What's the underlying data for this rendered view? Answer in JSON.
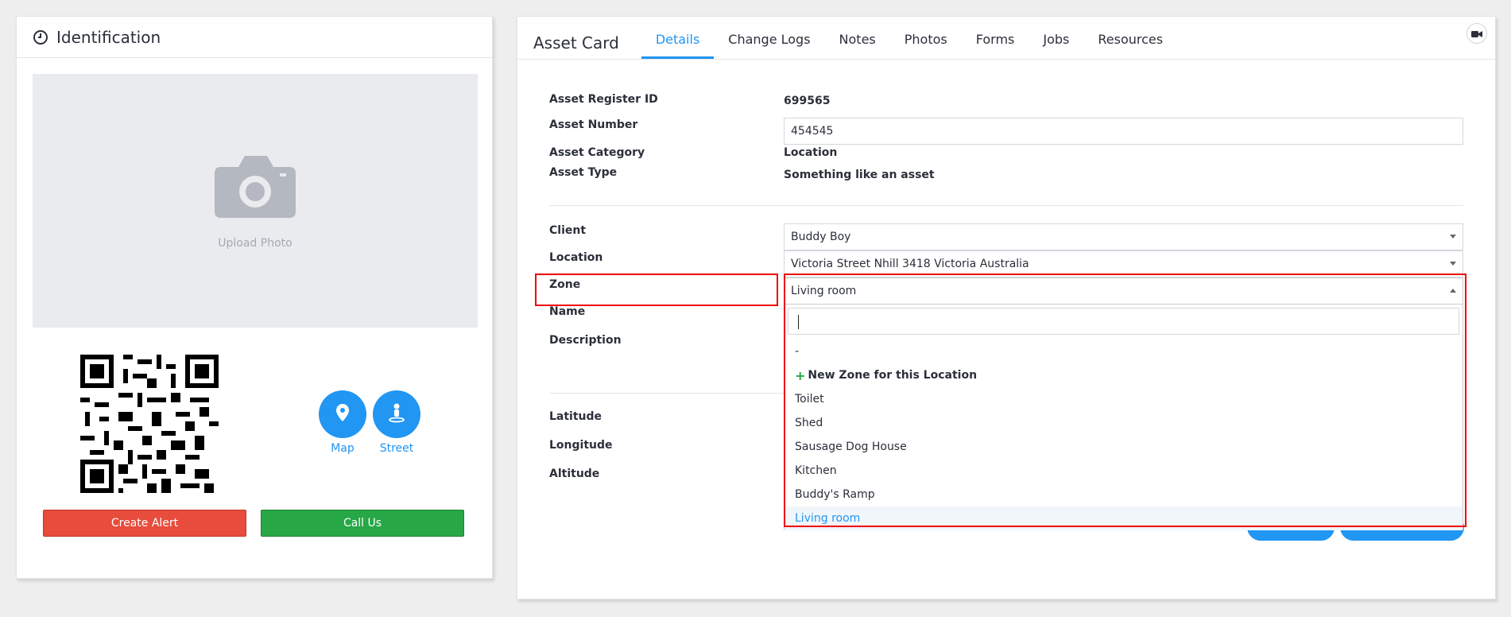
{
  "left_panel": {
    "title": "Identification",
    "upload_label": "Upload Photo",
    "map_label": "Map",
    "street_label": "Street",
    "create_alert_label": "Create Alert",
    "call_us_label": "Call Us"
  },
  "right_panel": {
    "title": "Asset Card",
    "tabs": [
      {
        "label": "Details",
        "active": true
      },
      {
        "label": "Change Logs"
      },
      {
        "label": "Notes"
      },
      {
        "label": "Photos"
      },
      {
        "label": "Forms"
      },
      {
        "label": "Jobs"
      },
      {
        "label": "Resources"
      }
    ]
  },
  "details": {
    "asset_register_id_label": "Asset Register ID",
    "asset_register_id_value": "699565",
    "asset_number_label": "Asset Number",
    "asset_number_value": "454545",
    "asset_category_label": "Asset Category",
    "asset_category_value": "Location",
    "asset_type_label": "Asset Type",
    "asset_type_value": "Something like an asset",
    "client_label": "Client",
    "client_value": "Buddy Boy",
    "location_label": "Location",
    "location_value": "Victoria Street Nhill 3418 Victoria Australia",
    "zone_label": "Zone",
    "zone_value": "Living room",
    "name_label": "Name",
    "description_label": "Description",
    "latitude_label": "Latitude",
    "longitude_label": "Longitude",
    "altitude_label": "Altitude"
  },
  "zone_dropdown": {
    "search_value": "",
    "options": [
      {
        "label": "-"
      },
      {
        "label": "New Zone for this Location"
      },
      {
        "label": "Toilet"
      },
      {
        "label": "Shed"
      },
      {
        "label": "Sausage Dog House"
      },
      {
        "label": "Kitchen"
      },
      {
        "label": "Buddy's Ramp"
      },
      {
        "label": "Living room"
      }
    ]
  },
  "colors": {
    "accent": "#2196f3",
    "alert": "#e74c3c",
    "call": "#27a745",
    "highlight": "#ee0000"
  }
}
